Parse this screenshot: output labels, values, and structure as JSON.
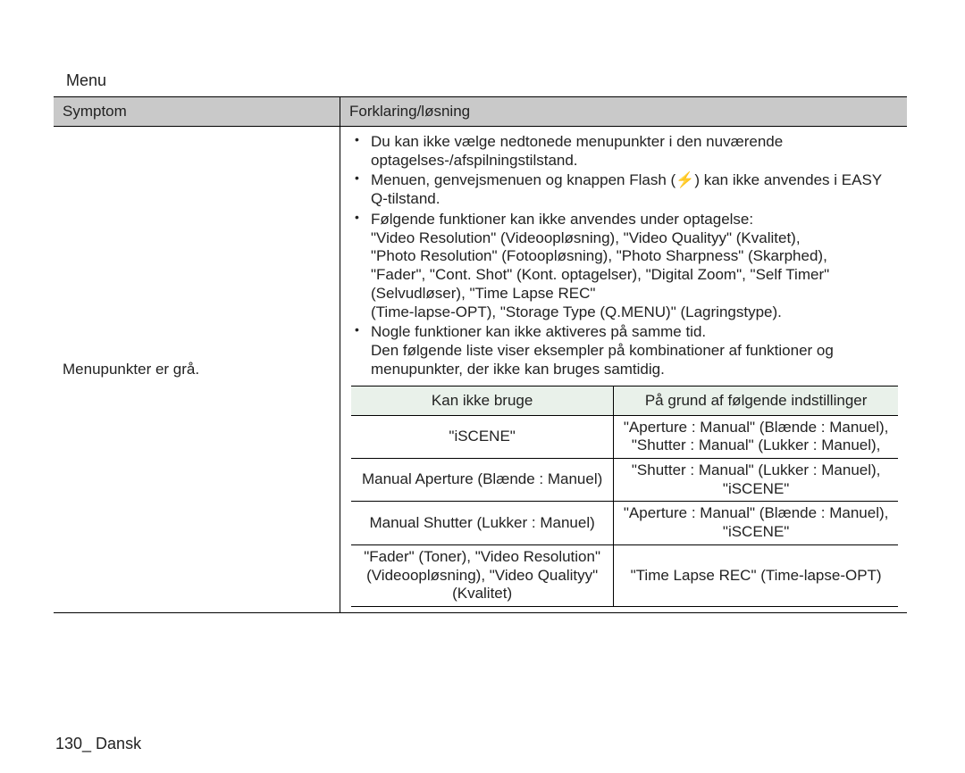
{
  "title": "Menu",
  "headers": {
    "symptom": "Symptom",
    "explanation": "Forklaring/løsning"
  },
  "row": {
    "symptom": "Menupunkter er grå.",
    "bullets": {
      "b1": "Du kan ikke vælge nedtonede menupunkter i den nuværende optagelses-/afspilningstilstand.",
      "b2a": "Menuen, genvejsmenuen og knappen Flash (",
      "b2b": ") kan ikke anvendes i EASY Q-tilstand.",
      "b3_lead": "Følgende funktioner kan ikke anvendes under optagelse:",
      "b3_line1": "\"Video Resolution\" (Videoopløsning), \"Video Qualityy\" (Kvalitet),",
      "b3_line2": "\"Photo Resolution\" (Fotoopløsning), \"Photo Sharpness\" (Skarphed),",
      "b3_line3": "\"Fader\", \"Cont. Shot\" (Kont. optagelser), \"Digital Zoom\", \"Self Timer\" (Selvudløser), \"Time Lapse REC\"",
      "b3_line4": "(Time-lapse-OPT), \"Storage Type (Q.MENU)\" (Lagringstype).",
      "b4_line1": "Nogle funktioner kan ikke aktiveres på samme tid.",
      "b4_line2": "Den følgende liste viser eksempler på kombinationer af funktioner og menupunkter, der ikke kan bruges samtidig."
    },
    "innerHeaders": {
      "cannot": "Kan ikke bruge",
      "because": "På grund af følgende indstillinger"
    },
    "innerRows": {
      "r1a": "\"iSCENE\"",
      "r1b": "\"Aperture : Manual\" (Blænde : Manuel), \"Shutter : Manual\" (Lukker : Manuel),",
      "r2a": "Manual Aperture (Blænde : Manuel)",
      "r2b": "\"Shutter : Manual\" (Lukker : Manuel), \"iSCENE\"",
      "r3a": "Manual Shutter (Lukker : Manuel)",
      "r3b": "\"Aperture : Manual\" (Blænde : Manuel), \"iSCENE\"",
      "r4a": "\"Fader\" (Toner), \"Video Resolution\" (Videoopløsning), \"Video Qualityy\" (Kvalitet)",
      "r4b": "\"Time Lapse REC\" (Time-lapse-OPT)"
    }
  },
  "page_footer": "130_ Dansk"
}
